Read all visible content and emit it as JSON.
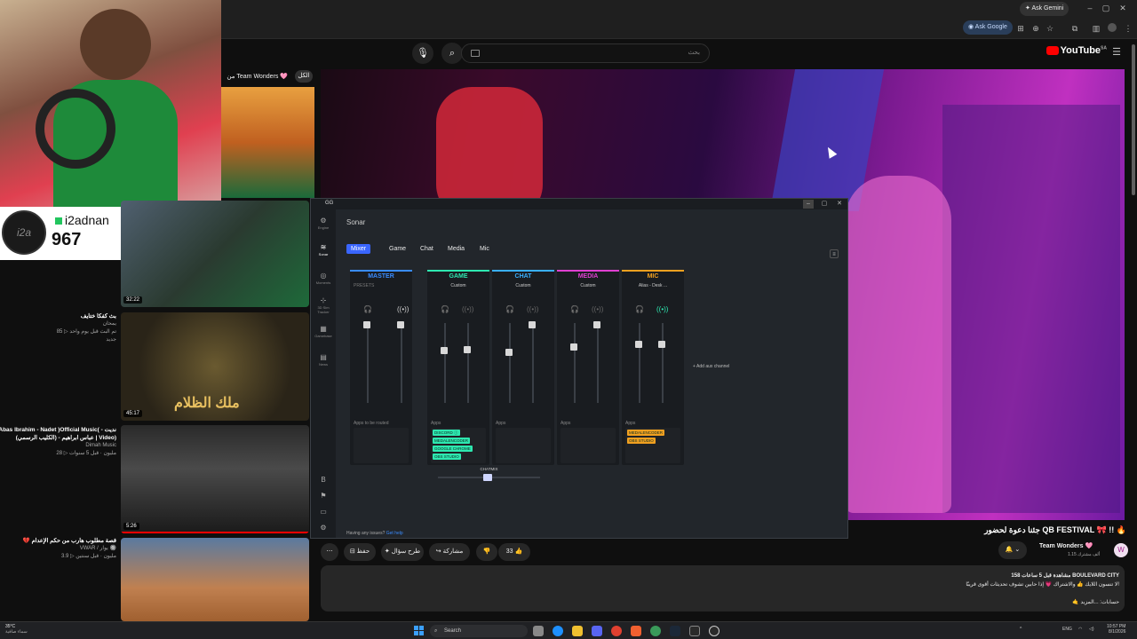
{
  "browser": {
    "gemini_label": "Ask Gemini",
    "google_label": "Ask Google"
  },
  "youtube": {
    "logo": "YouTube",
    "logo_region": "SA",
    "search_placeholder": "بحث",
    "search_value": ""
  },
  "webcam_counter": {
    "name": "i2adnan",
    "count": "967",
    "logo_text": "i2a"
  },
  "sidebar_videos": [
    {
      "title": "بث كفكا ختايف",
      "channel": "يمحان",
      "meta": "85 ▷ تم البث قبل يوم واحد",
      "extra": "جديد"
    },
    {
      "title": "Abas Ibrahim - Nadet )Official Music( نديت - عباس ابراهيم - (الكليب الرسمي) | Video)",
      "channel": "Dimah Music",
      "meta": "28 ▷ مليون · قبل 5 سنوات"
    },
    {
      "title": "💔 قصة مطلوب هارب من حكم الإعدام",
      "channel": "VWAR / يوار 🔘",
      "meta": "3.9 ▷ مليون · قبل سنتين"
    }
  ],
  "thumbnails": [
    {
      "duration": "32:22"
    },
    {
      "duration": "45:17",
      "overlay_text": "ملك الظلام"
    },
    {
      "duration": "5:26"
    },
    {
      "duration": ""
    }
  ],
  "tw_card": {
    "label": "من Team Wonders 🩷",
    "button": "الكل"
  },
  "sonar": {
    "app_title": "GG",
    "heading": "Sonar",
    "nav": [
      "Engine",
      "Sonar",
      "Moments",
      "3D Sim Tracker",
      "Gamebase",
      "News"
    ],
    "tabs": [
      "Mixer",
      "Game",
      "Chat",
      "Media",
      "Mic"
    ],
    "channels": [
      {
        "name": "MASTER",
        "sub": "PRESETS",
        "color": "#3a8cff",
        "apps_label": "Apps to be routed",
        "apps": []
      },
      {
        "name": "GAME",
        "sub": "Custom",
        "color": "#2ee8b0",
        "apps_label": "Apps",
        "apps": [
          "DISCORD ⓘ",
          "MEDALENCODER",
          "GOOGLE CHROME",
          "OBS STUDIO"
        ]
      },
      {
        "name": "CHAT",
        "sub": "Custom",
        "color": "#3ab0ff",
        "apps_label": "Apps",
        "apps": []
      },
      {
        "name": "MEDIA",
        "sub": "Custom",
        "color": "#e040d0",
        "apps_label": "Apps",
        "apps": []
      },
      {
        "name": "MIC",
        "sub": "Alias - Desk ...",
        "color": "#f0a020",
        "apps_label": "Apps",
        "apps": [
          "MEDALENCODER",
          "OBS STUDIO"
        ]
      }
    ],
    "add_aux": "+ Add aux channel",
    "chatmix": "CHATMIX",
    "issue_text": "Having any issues?",
    "issue_link": "Get help"
  },
  "video": {
    "title": "جئنا دعوة لحضور QB FESTIVAL 🎀 !! 🔥",
    "channel": "Team Wonders 🩷",
    "subscribers": "1.15 ألف مشترك",
    "likes": "33",
    "share": "مشاركة",
    "ask": "طرح سؤال",
    "save": "حفظ",
    "description_line1": "158 مشاهدة قبل 5 ساعات   BOULEVARD CITY",
    "description_line2": "لا تنسون اللايك 👍 والاشتراك 💗 إذا حابين تشوف تحديثات أقوى قريبًا!",
    "description_line3": "🤙 حسابات: ...المزيد"
  },
  "taskbar": {
    "weather": "35°C",
    "weather_sub": "سماء صافية",
    "search": "Search",
    "lang": "ENG",
    "time": "10:57 PM",
    "date": "8/1/2026"
  }
}
